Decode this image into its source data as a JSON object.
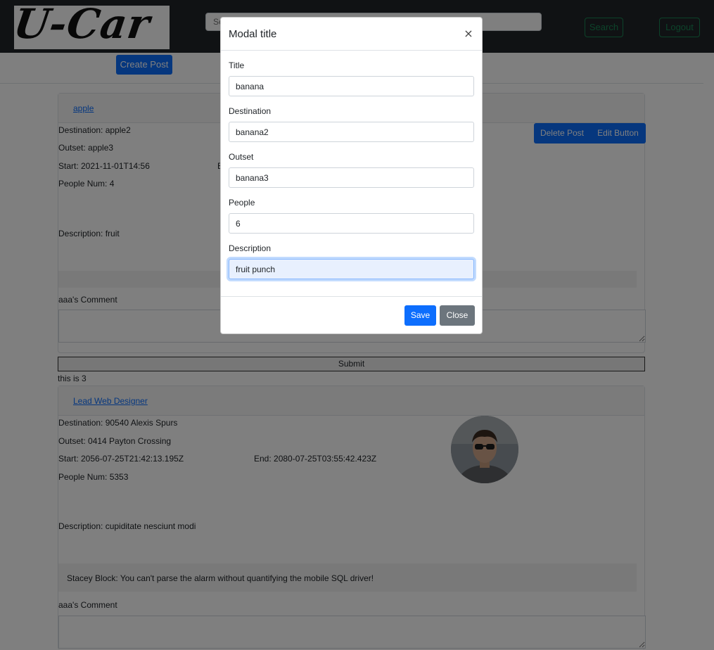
{
  "navbar": {
    "logo_text": "U-Car",
    "search_placeholder": "Search",
    "search_button": "Search",
    "logout_button": "Logout"
  },
  "create_post_button": "Create Post",
  "posts": [
    {
      "title": "apple",
      "destination": "Destination: apple2",
      "outset": "Outset: apple3",
      "start": "Start: 2021-11-01T14:56",
      "end": "E",
      "people": "People Num: 4",
      "description": "Description: fruit",
      "delete_button": "Delete Post",
      "edit_button": "Edit Button",
      "comment_label": "aaa's Comment",
      "submit_button": "Submit",
      "footer_text": "this is 3"
    },
    {
      "title": "Lead Web Designer",
      "destination": "Destination: 90540 Alexis Spurs",
      "outset": "Outset: 0414 Payton Crossing",
      "start": "Start: 2056-07-25T21:42:13.195Z",
      "end": "End: 2080-07-25T03:55:42.423Z",
      "people": "People Num: 5353",
      "description": "Description: cupiditate nesciunt modi",
      "comment": "Stacey Block: You can't parse the alarm without quantifying the mobile SQL driver!",
      "comment_label": "aaa's Comment"
    }
  ],
  "modal": {
    "title": "Modal title",
    "close_symbol": "×",
    "fields": [
      {
        "label": "Title",
        "value": "banana"
      },
      {
        "label": "Destination",
        "value": "banana2"
      },
      {
        "label": "Outset",
        "value": "banana3"
      },
      {
        "label": "People",
        "value": "6"
      },
      {
        "label": "Description",
        "value": "fruit punch"
      }
    ],
    "save_button": "Save",
    "close_button": "Close"
  }
}
